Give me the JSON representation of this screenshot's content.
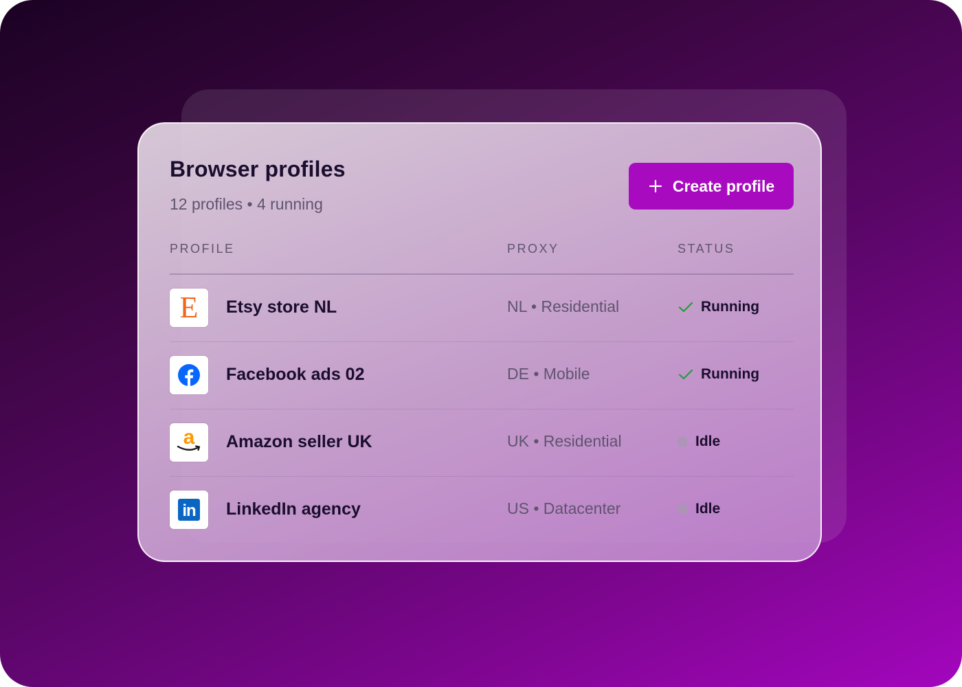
{
  "card": {
    "title": "Browser profiles",
    "subtitle": "12 profiles • 4 running",
    "create_button_label": "Create profile"
  },
  "colors": {
    "accent": "#a80bbf",
    "running_check": "#1f9d3a",
    "idle_dot": "#aa96b4"
  },
  "table": {
    "headers": {
      "profile": "PROFILE",
      "proxy": "PROXY",
      "status": "STATUS"
    },
    "rows": [
      {
        "name": "Etsy store NL",
        "proxy": "NL • Residential",
        "status": "Running",
        "logo": "etsy-logo",
        "logo_text": "E"
      },
      {
        "name": "Facebook ads 02",
        "proxy": "DE • Mobile",
        "status": "Running",
        "logo": "facebook-logo"
      },
      {
        "name": "Amazon seller UK",
        "proxy": "UK • Residential",
        "status": "Idle",
        "logo": "amazon-logo",
        "logo_text": "a"
      },
      {
        "name": "LinkedIn agency",
        "proxy": "US • Datacenter",
        "status": "Idle",
        "logo": "linkedin-logo",
        "logo_text": "in"
      }
    ]
  }
}
